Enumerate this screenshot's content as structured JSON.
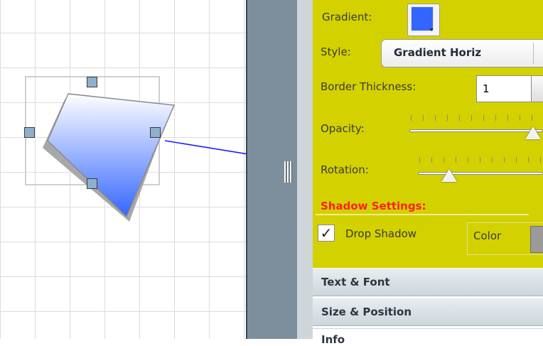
{
  "properties": {
    "gradient_label": "Gradient:",
    "gradient_color": "#3366ff",
    "style_label": "Style:",
    "style_value": "Gradient Horiz",
    "border_thickness_label": "Border Thickness:",
    "border_thickness_value": "1",
    "opacity_label": "Opacity:",
    "opacity_level": 1.0,
    "rotation_label": "Rotation:",
    "rotation_level": 0.25
  },
  "shadow": {
    "section_title": "Shadow Settings:",
    "drop_shadow_label": "Drop Shadow",
    "drop_shadow_checked": "✓",
    "color_label": "Color",
    "color_value": "#9a9a9a"
  },
  "accordion": {
    "items": [
      {
        "label": "Text & Font"
      },
      {
        "label": "Size & Position"
      },
      {
        "label": "Info"
      }
    ]
  },
  "colors": {
    "panel_background": "#d4d100",
    "section_title": "#ff2020",
    "connector_line": "#1a1aff",
    "shape_gradient_top": "#ffffff",
    "shape_gradient_bottom": "#3366ff"
  }
}
